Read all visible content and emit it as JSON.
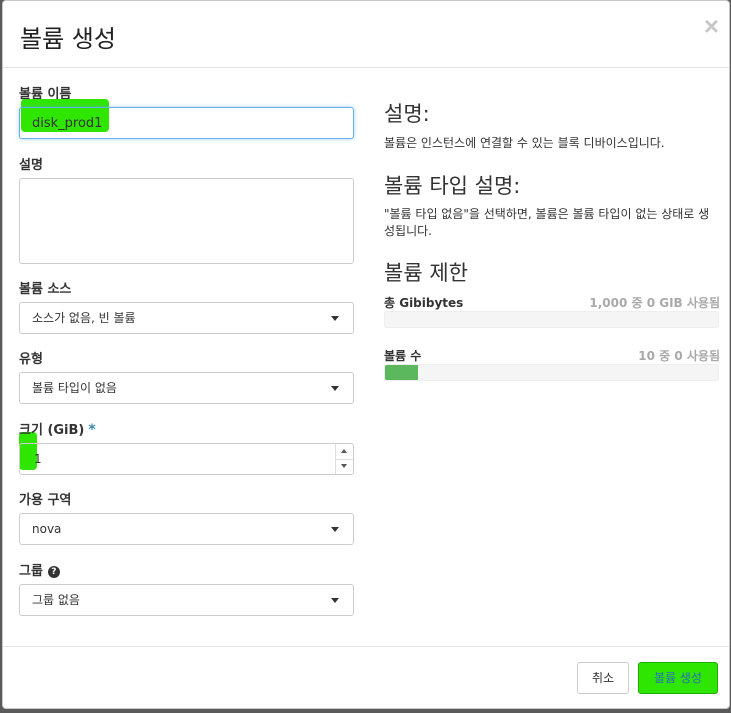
{
  "dialog": {
    "title": "볼륨 생성",
    "close_icon": "×"
  },
  "form": {
    "name_label": "볼륨 이름",
    "name_value": "disk_prod1",
    "description_label": "설명",
    "source_label": "볼륨 소스",
    "source_value": "소스가 없음, 빈 볼륨",
    "type_label": "유형",
    "type_value": "볼륨 타입이 없음",
    "size_label": "크기 (GiB)",
    "size_required": "*",
    "size_value": "1",
    "az_label": "가용 구역",
    "az_value": "nova",
    "group_label": "그룹",
    "group_help_icon": "?",
    "group_value": "그룹 없음"
  },
  "info": {
    "desc_heading": "설명:",
    "desc_text": "볼륨은 인스턴스에 연결할 수 있는 블록 디바이스입니다.",
    "type_heading": "볼륨 타입 설명:",
    "type_text": "\"볼륨 타입 없음\"을 선택하면, 볼륨은 볼륨 타입이 없는 상태로 생성됩니다.",
    "limits_heading": "볼륨 제한",
    "quotas": [
      {
        "label": "총 Gibibytes",
        "usage": "1,000 중 0 GIB 사용됨",
        "fraction": 0.0
      },
      {
        "label": "볼륨 수",
        "usage": "10 중 0 사용됨",
        "fraction": 0.1
      }
    ]
  },
  "footer": {
    "cancel_label": "취소",
    "submit_label": "볼륨 생성"
  },
  "colors": {
    "highlight": "#2ee600",
    "bar_fill": "#5cb85c",
    "required": "#3a87ad"
  }
}
